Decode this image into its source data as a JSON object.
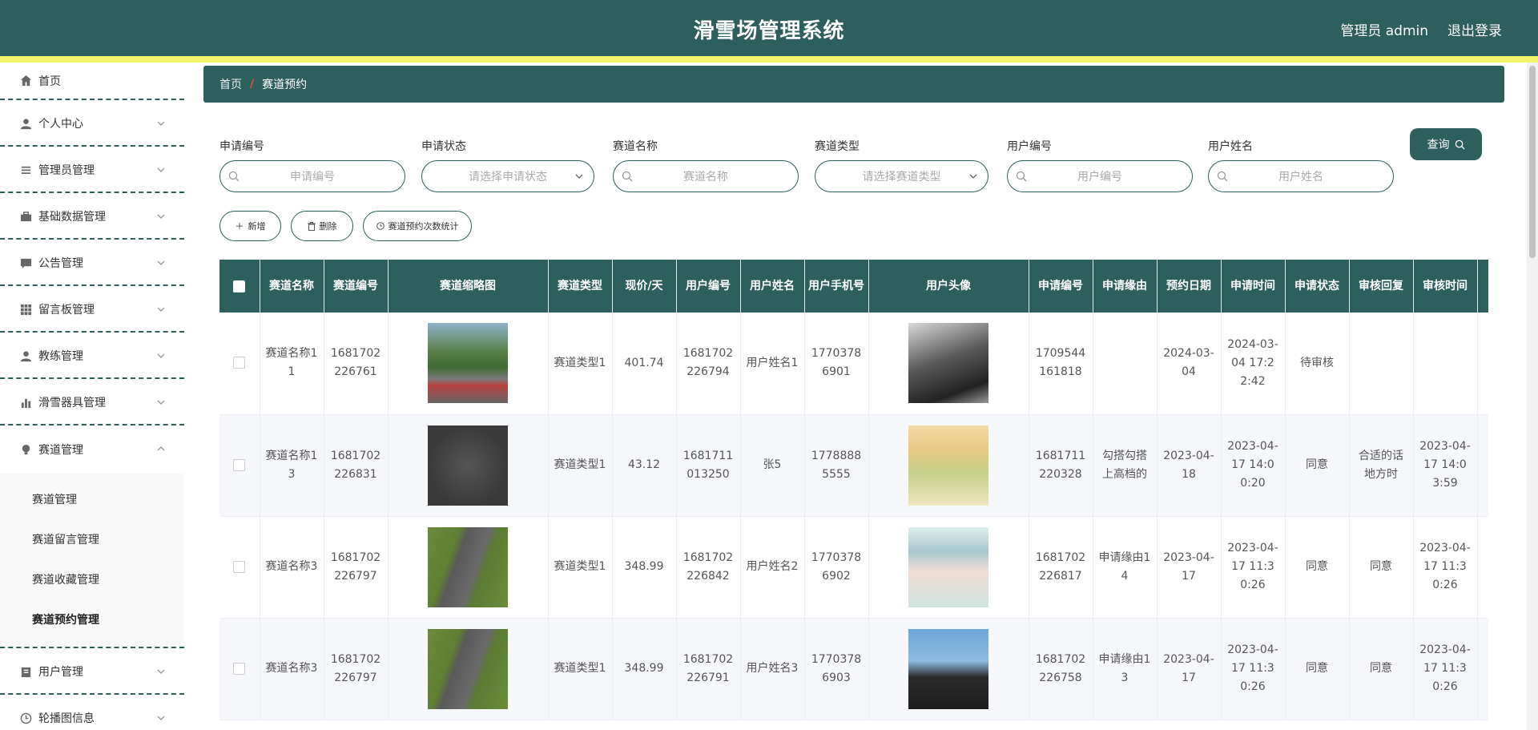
{
  "header": {
    "title": "滑雪场管理系统",
    "user": "管理员 admin",
    "logout": "退出登录"
  },
  "sidebar": {
    "items": [
      {
        "label": "首页",
        "icon": "home-icon"
      },
      {
        "label": "个人中心",
        "icon": "user-icon"
      },
      {
        "label": "管理员管理",
        "icon": "list-icon"
      },
      {
        "label": "基础数据管理",
        "icon": "briefcase-icon"
      },
      {
        "label": "公告管理",
        "icon": "message-icon"
      },
      {
        "label": "留言板管理",
        "icon": "grid-icon"
      },
      {
        "label": "教练管理",
        "icon": "user-icon"
      },
      {
        "label": "滑雪器具管理",
        "icon": "chart-icon"
      },
      {
        "label": "赛道管理",
        "icon": "bulb-icon"
      },
      {
        "label": "用户管理",
        "icon": "clipboard-icon"
      },
      {
        "label": "轮播图信息",
        "icon": "clock-icon"
      }
    ],
    "submenu": [
      "赛道管理",
      "赛道留言管理",
      "赛道收藏管理",
      "赛道预约管理"
    ]
  },
  "breadcrumb": {
    "home": "首页",
    "current": "赛道预约"
  },
  "search": {
    "fields": [
      {
        "label": "申请编号",
        "placeholder": "申请编号"
      },
      {
        "label": "申请状态",
        "placeholder": "请选择申请状态"
      },
      {
        "label": "赛道名称",
        "placeholder": "赛道名称"
      },
      {
        "label": "赛道类型",
        "placeholder": "请选择赛道类型"
      },
      {
        "label": "用户编号",
        "placeholder": "用户编号"
      },
      {
        "label": "用户姓名",
        "placeholder": "用户姓名"
      }
    ],
    "query_label": "查询"
  },
  "actions": {
    "add": "新增",
    "delete": "删除",
    "stats": "赛道预约次数统计"
  },
  "table": {
    "headers": [
      "赛道名称",
      "赛道编号",
      "赛道缩略图",
      "赛道类型",
      "现价/天",
      "用户编号",
      "用户姓名",
      "用户手机号",
      "用户头像",
      "申请编号",
      "申请缘由",
      "预约日期",
      "申请时间",
      "申请状态",
      "审核回复",
      "审核时间"
    ],
    "rows": [
      {
        "track_name": "赛道名称11",
        "track_no": "1681702226761",
        "track_type": "赛道类型1",
        "price": "401.74",
        "user_no": "1681702226794",
        "user_name": "用户姓名1",
        "phone": "17703786901",
        "apply_no": "1709544161818",
        "reason": "",
        "date": "2024-03-04",
        "apply_time": "2024-03-04 17:22:42",
        "status": "待审核",
        "reply": "",
        "review_time": ""
      },
      {
        "track_name": "赛道名称13",
        "track_no": "1681702226831",
        "track_type": "赛道类型1",
        "price": "43.12",
        "user_no": "1681711013250",
        "user_name": "张5",
        "phone": "17788885555",
        "apply_no": "1681711220328",
        "reason": "勾搭勾搭上高档的",
        "date": "2023-04-18",
        "apply_time": "2023-04-17 14:00:20",
        "status": "同意",
        "reply": "合适的话地方时",
        "review_time": "2023-04-17 14:03:59"
      },
      {
        "track_name": "赛道名称3",
        "track_no": "1681702226797",
        "track_type": "赛道类型1",
        "price": "348.99",
        "user_no": "1681702226842",
        "user_name": "用户姓名2",
        "phone": "17703786902",
        "apply_no": "1681702226817",
        "reason": "申请缘由14",
        "date": "2023-04-17",
        "apply_time": "2023-04-17 11:30:26",
        "status": "同意",
        "reply": "同意",
        "review_time": "2023-04-17 11:30:26"
      },
      {
        "track_name": "赛道名称3",
        "track_no": "1681702226797",
        "track_type": "赛道类型1",
        "price": "348.99",
        "user_no": "1681702226791",
        "user_name": "用户姓名3",
        "phone": "17703786903",
        "apply_no": "1681702226758",
        "reason": "申请缘由13",
        "date": "2023-04-17",
        "apply_time": "2023-04-17 11:30:26",
        "status": "同意",
        "reply": "同意",
        "review_time": "2023-04-17 11:30:26"
      }
    ]
  },
  "colors": {
    "primary": "#2d5f5d",
    "accent_stripe": "#f4f46a",
    "crumb_separator": "#e74c3c"
  }
}
